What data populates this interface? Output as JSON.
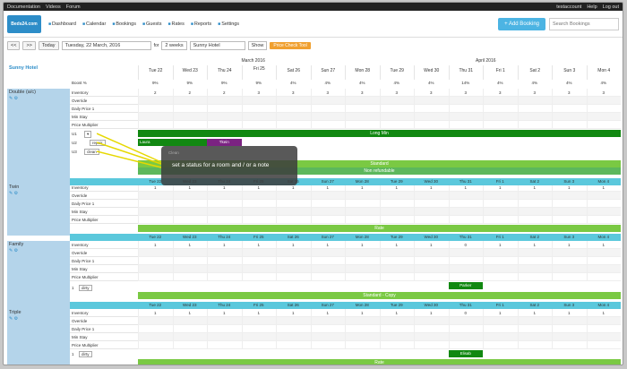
{
  "topbar": {
    "links": [
      "Documentation",
      "Videos",
      "Forum"
    ],
    "account": "testaccount",
    "help": "Help",
    "logout": "Log out"
  },
  "logo": "Beds24.com",
  "nav": [
    {
      "label": "Dashboard",
      "icon": "dashboard-icon"
    },
    {
      "label": "Calendar",
      "icon": "calendar-icon"
    },
    {
      "label": "Bookings",
      "icon": "bookings-icon"
    },
    {
      "label": "Guests",
      "icon": "guests-icon"
    },
    {
      "label": "Rates",
      "icon": "rates-icon"
    },
    {
      "label": "Reports",
      "icon": "reports-icon"
    },
    {
      "label": "Settings",
      "icon": "settings-icon"
    }
  ],
  "add_booking": "Add Booking",
  "search_placeholder": "Search Bookings",
  "controls": {
    "prev": "<<",
    "next": ">>",
    "today": "Today",
    "date": "Tuesday, 22 March, 2016",
    "for": "for",
    "weeks": "2 weeks",
    "property": "Sunny Hotel",
    "show": "Show",
    "price_check": "Price Check Tool"
  },
  "months": [
    "March 2016",
    "April 2016"
  ],
  "property_name": "Sunny Hotel",
  "days": [
    "Tue 22",
    "Wed 23",
    "Thu 24",
    "Fri 25",
    "Sat 26",
    "Sun 27",
    "Mon 28",
    "Tue 29",
    "Wed 30",
    "Thu 31",
    "Fri 1",
    "Sat 2",
    "Sun 3",
    "Mon 4"
  ],
  "boost_label": "Boost %",
  "boost": [
    "9%",
    "9%",
    "9%",
    "9%",
    "4%",
    "4%",
    "4%",
    "4%",
    "4%",
    "14%",
    "4%",
    "4%",
    "4%",
    "4%"
  ],
  "room_sub_labels": [
    "Inventory",
    "Override",
    "Daily Price 1",
    "Min Stay",
    "Price Multiplier"
  ],
  "rooms": [
    {
      "name": "Double (a/c)",
      "inv": [
        "2",
        "2",
        "2",
        "3",
        "3",
        "3",
        "3",
        "3",
        "3",
        "3",
        "3",
        "3",
        "3",
        "3"
      ]
    },
    {
      "name": "Twin",
      "inv": [
        "1",
        "1",
        "1",
        "1",
        "1",
        "1",
        "1",
        "1",
        "1",
        "1",
        "1",
        "1",
        "1",
        "1"
      ]
    },
    {
      "name": "Family",
      "inv": [
        "1",
        "1",
        "1",
        "1",
        "1",
        "1",
        "1",
        "1",
        "1",
        "0",
        "1",
        "1",
        "1",
        "1"
      ]
    },
    {
      "name": "Triple",
      "inv": [
        "1",
        "1",
        "1",
        "1",
        "1",
        "1",
        "1",
        "1",
        "1",
        "0",
        "1",
        "1",
        "1",
        "1"
      ]
    }
  ],
  "units": {
    "u1": "U1",
    "u1s": "clean",
    "u2": "U2",
    "u2s": "repair",
    "u3": "U3",
    "u3s": "clean",
    "f1": "1",
    "f1s": "dirty",
    "t1": "1",
    "t1s": "dirty"
  },
  "bars": {
    "longmin": "Long Min",
    "standard": "Standard",
    "nonref": "Non refundable",
    "rate": "Rate",
    "stdcopy": "Standard - Copy",
    "rate2": "Rate"
  },
  "bookings": {
    "laura": "Laura",
    "tkein": "Tkein",
    "parker": "Parker",
    "elisab": "Elisab"
  },
  "tooltip": "set a status for a room and / or a note",
  "tooltip_head": "Clean"
}
